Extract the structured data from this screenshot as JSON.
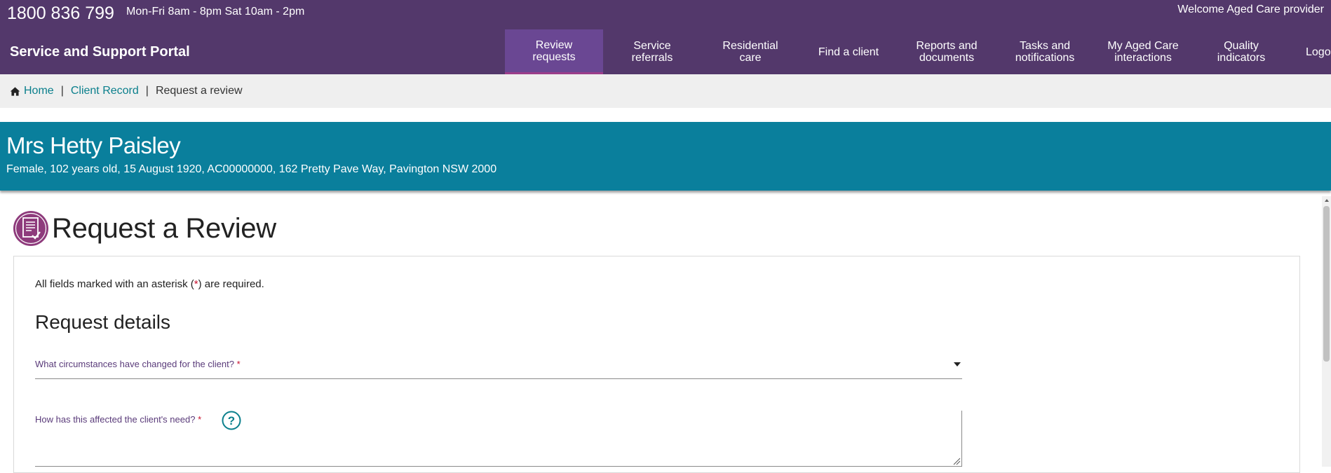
{
  "header": {
    "phone": "1800 836 799",
    "hours": "Mon-Fri 8am - 8pm Sat 10am - 2pm",
    "welcome": "Welcome Aged Care provider",
    "portal_title": "Service and Support Portal"
  },
  "nav": {
    "items": [
      {
        "label": "Review\nrequests",
        "active": true
      },
      {
        "label": "Service\nreferrals"
      },
      {
        "label": "Residential\ncare"
      },
      {
        "label": "Find a client"
      },
      {
        "label": "Reports and\ndocuments"
      },
      {
        "label": "Tasks and\nnotifications"
      },
      {
        "label": "My Aged Care\ninteractions"
      },
      {
        "label": "Quality\nindicators"
      },
      {
        "label": "Logout"
      }
    ]
  },
  "breadcrumb": {
    "home": "Home",
    "client_record": "Client Record",
    "current": "Request a review",
    "separator": "|"
  },
  "client": {
    "name": "Mrs Hetty Paisley",
    "details": "Female, 102 years old, 15 August 1920, AC00000000, 162 Pretty Pave Way, Pavington NSW 2000"
  },
  "page": {
    "title": "Request a Review"
  },
  "form": {
    "required_note_prefix": "All fields marked with an asterisk (",
    "required_note_asterisk": "*",
    "required_note_suffix": ") are required.",
    "section_title": "Request details",
    "circumstances_label": "What circumstances have changed for the client?",
    "affected_label": "How has this affected the client's need?",
    "required_mark": "*",
    "affected_value": ""
  },
  "colors": {
    "header_purple": "#53386b",
    "active_tab": "#6a4793",
    "teal_banner": "#0a7f9c",
    "link_teal": "#0a7f8c",
    "icon_plum": "#8e3b7c",
    "required_red": "#c8102e"
  },
  "icons": {
    "home": "home-icon",
    "title": "document-check-icon",
    "help": "question-mark-icon",
    "dropdown": "caret-down-icon"
  }
}
